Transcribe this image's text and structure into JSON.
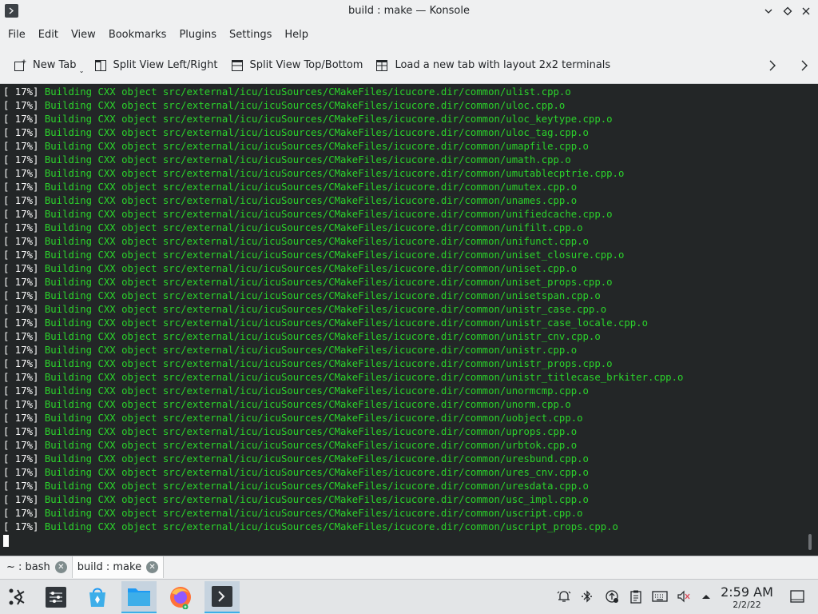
{
  "window": {
    "title": "build : make — Konsole",
    "app_icon": "terminal-icon"
  },
  "menu": [
    "File",
    "Edit",
    "View",
    "Bookmarks",
    "Plugins",
    "Settings",
    "Help"
  ],
  "toolbar": {
    "new_tab": "New Tab",
    "split_lr": "Split View Left/Right",
    "split_tb": "Split View Top/Bottom",
    "load_layout": "Load a new tab with layout 2x2 terminals"
  },
  "terminal": {
    "prefix": "[ 17%] ",
    "lines": [
      "Building CXX object src/external/icu/icuSources/CMakeFiles/icucore.dir/common/ulist.cpp.o",
      "Building CXX object src/external/icu/icuSources/CMakeFiles/icucore.dir/common/uloc.cpp.o",
      "Building CXX object src/external/icu/icuSources/CMakeFiles/icucore.dir/common/uloc_keytype.cpp.o",
      "Building CXX object src/external/icu/icuSources/CMakeFiles/icucore.dir/common/uloc_tag.cpp.o",
      "Building CXX object src/external/icu/icuSources/CMakeFiles/icucore.dir/common/umapfile.cpp.o",
      "Building CXX object src/external/icu/icuSources/CMakeFiles/icucore.dir/common/umath.cpp.o",
      "Building CXX object src/external/icu/icuSources/CMakeFiles/icucore.dir/common/umutablecptrie.cpp.o",
      "Building CXX object src/external/icu/icuSources/CMakeFiles/icucore.dir/common/umutex.cpp.o",
      "Building CXX object src/external/icu/icuSources/CMakeFiles/icucore.dir/common/unames.cpp.o",
      "Building CXX object src/external/icu/icuSources/CMakeFiles/icucore.dir/common/unifiedcache.cpp.o",
      "Building CXX object src/external/icu/icuSources/CMakeFiles/icucore.dir/common/unifilt.cpp.o",
      "Building CXX object src/external/icu/icuSources/CMakeFiles/icucore.dir/common/unifunct.cpp.o",
      "Building CXX object src/external/icu/icuSources/CMakeFiles/icucore.dir/common/uniset_closure.cpp.o",
      "Building CXX object src/external/icu/icuSources/CMakeFiles/icucore.dir/common/uniset.cpp.o",
      "Building CXX object src/external/icu/icuSources/CMakeFiles/icucore.dir/common/uniset_props.cpp.o",
      "Building CXX object src/external/icu/icuSources/CMakeFiles/icucore.dir/common/unisetspan.cpp.o",
      "Building CXX object src/external/icu/icuSources/CMakeFiles/icucore.dir/common/unistr_case.cpp.o",
      "Building CXX object src/external/icu/icuSources/CMakeFiles/icucore.dir/common/unistr_case_locale.cpp.o",
      "Building CXX object src/external/icu/icuSources/CMakeFiles/icucore.dir/common/unistr_cnv.cpp.o",
      "Building CXX object src/external/icu/icuSources/CMakeFiles/icucore.dir/common/unistr.cpp.o",
      "Building CXX object src/external/icu/icuSources/CMakeFiles/icucore.dir/common/unistr_props.cpp.o",
      "Building CXX object src/external/icu/icuSources/CMakeFiles/icucore.dir/common/unistr_titlecase_brkiter.cpp.o",
      "Building CXX object src/external/icu/icuSources/CMakeFiles/icucore.dir/common/unormcmp.cpp.o",
      "Building CXX object src/external/icu/icuSources/CMakeFiles/icucore.dir/common/unorm.cpp.o",
      "Building CXX object src/external/icu/icuSources/CMakeFiles/icucore.dir/common/uobject.cpp.o",
      "Building CXX object src/external/icu/icuSources/CMakeFiles/icucore.dir/common/uprops.cpp.o",
      "Building CXX object src/external/icu/icuSources/CMakeFiles/icucore.dir/common/urbtok.cpp.o",
      "Building CXX object src/external/icu/icuSources/CMakeFiles/icucore.dir/common/uresbund.cpp.o",
      "Building CXX object src/external/icu/icuSources/CMakeFiles/icucore.dir/common/ures_cnv.cpp.o",
      "Building CXX object src/external/icu/icuSources/CMakeFiles/icucore.dir/common/uresdata.cpp.o",
      "Building CXX object src/external/icu/icuSources/CMakeFiles/icucore.dir/common/usc_impl.cpp.o",
      "Building CXX object src/external/icu/icuSources/CMakeFiles/icucore.dir/common/uscript.cpp.o",
      "Building CXX object src/external/icu/icuSources/CMakeFiles/icucore.dir/common/uscript_props.cpp.o"
    ]
  },
  "tabs": [
    {
      "label": "~ : bash",
      "active": false
    },
    {
      "label": "build : make",
      "active": true
    }
  ],
  "taskbar": {
    "apps": [
      "application-launcher-icon",
      "system-settings-icon",
      "discover-store-icon",
      "file-manager-icon",
      "firefox-icon",
      "konsole-icon"
    ],
    "tray": [
      "notifications-icon",
      "bluetooth-icon",
      "updates-icon",
      "clipboard-icon",
      "keyboard-icon",
      "volume-muted-icon",
      "tray-expand-icon"
    ],
    "time": "2:59 AM",
    "date": "2/2/22"
  },
  "colors": {
    "terminal_bg": "#232627",
    "terminal_text": "#fcfcfc",
    "build_text": "#2bd32b",
    "accent": "#3daee9"
  }
}
